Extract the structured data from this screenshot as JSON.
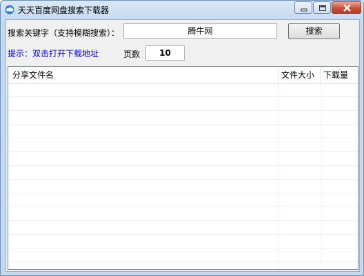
{
  "window": {
    "title": "天天百度网盘搜索下载器"
  },
  "search": {
    "label": "搜索关键字（支持模糊搜索）：",
    "value": "腾牛网",
    "button_label": "搜索"
  },
  "hint": "提示：双击打开下载地址",
  "pages": {
    "label": "页数",
    "value": "10"
  },
  "list": {
    "columns": [
      "分享文件名",
      "文件大小",
      "下载量"
    ],
    "rows": []
  },
  "colors": {
    "titlebar": "#d9e8f7",
    "hint_text": "#0000ee",
    "close_button": "#c9503a"
  },
  "icons": [
    "cloud-icon",
    "minimize-icon",
    "maximize-icon",
    "close-icon"
  ]
}
